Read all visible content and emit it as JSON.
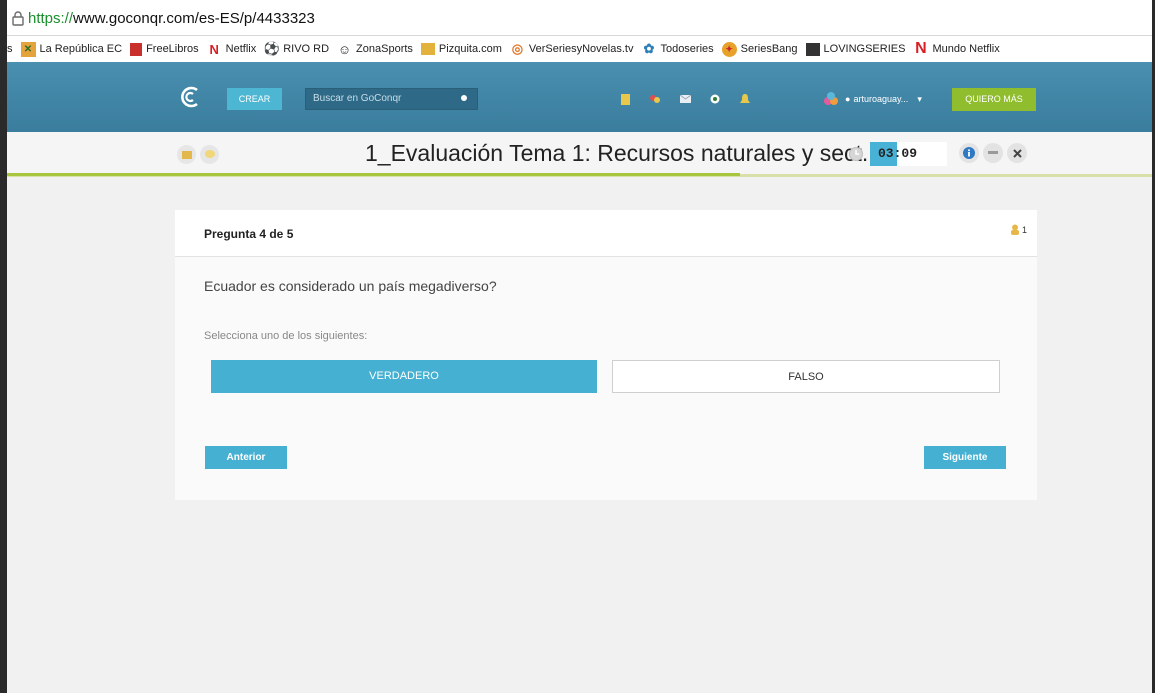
{
  "browser": {
    "url_protocol": "https://",
    "url_rest": "www.goconqr.com/es-ES/p/4433323",
    "bookmarks": [
      {
        "label": "s",
        "icon": "none"
      },
      {
        "label": "La República EC",
        "icon": "flag-icon"
      },
      {
        "label": "FreeLibros",
        "icon": "book-icon"
      },
      {
        "label": "Netflix",
        "icon": "netflix-icon"
      },
      {
        "label": "RIVO RD",
        "icon": "soccer-ball-icon"
      },
      {
        "label": "ZonaSports",
        "icon": "soccer-ball-icon"
      },
      {
        "label": "Pizquita.com",
        "icon": "folder-icon"
      },
      {
        "label": "VerSeriesyNovelas.tv",
        "icon": "tv-icon"
      },
      {
        "label": "Todoseries",
        "icon": "flower-icon"
      },
      {
        "label": "SeriesBang",
        "icon": "bang-icon"
      },
      {
        "label": "LOVINGSERIES",
        "icon": "film-icon"
      },
      {
        "label": "Mundo Netflix",
        "icon": "netflix-icon"
      }
    ]
  },
  "navbar": {
    "create_label": "CREAR",
    "search_placeholder": "Buscar en GoConqr",
    "username": "arturoaguay...",
    "upgrade_label": "QUIERO MÁS"
  },
  "titlebar": {
    "title": "1_Evaluación Tema 1: Recursos naturales y sect...",
    "timer": "03:09",
    "progress_fraction": 0.64
  },
  "quiz": {
    "question_counter": "Pregunta 4 de 5",
    "hint_count": "1",
    "question_text": "Ecuador es considerado un país megadiverso?",
    "instruction": "Selecciona uno de los siguientes:",
    "option_true": "VERDADERO",
    "option_false": "FALSO",
    "prev_label": "Anterior",
    "next_label": "Siguiente"
  },
  "colors": {
    "accent": "#45b0d1",
    "navbar": "#3f84a5",
    "upgrade": "#8fbd2d",
    "progress": "#a7c53f"
  }
}
